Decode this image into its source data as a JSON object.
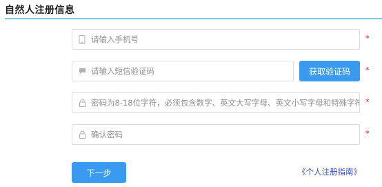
{
  "header": {
    "title": "自然人注册信息"
  },
  "form": {
    "phone": {
      "placeholder": "请输入手机号",
      "value": "",
      "icon": "phone-icon",
      "required_mark": "*"
    },
    "sms_code": {
      "placeholder": "请输入短信验证码",
      "value": "",
      "icon": "message-icon",
      "required_mark": "*"
    },
    "get_code_button": {
      "label": "获取验证码"
    },
    "password": {
      "placeholder": "密码为8-18位字符，必须包含数字、英文大写字母、英文小写字母和特殊字符",
      "value": "",
      "icon": "lock-icon",
      "required_mark": "*"
    },
    "confirm_password": {
      "placeholder": "确认密码",
      "value": "",
      "icon": "lock-icon",
      "required_mark": "*"
    }
  },
  "actions": {
    "next_label": "下一步",
    "guide_link": "《个人注册指南》"
  },
  "colors": {
    "accent": "#3a9af0",
    "title_underline": "#7cc3ea",
    "required": "#e02020",
    "link": "#3a4fd0"
  }
}
